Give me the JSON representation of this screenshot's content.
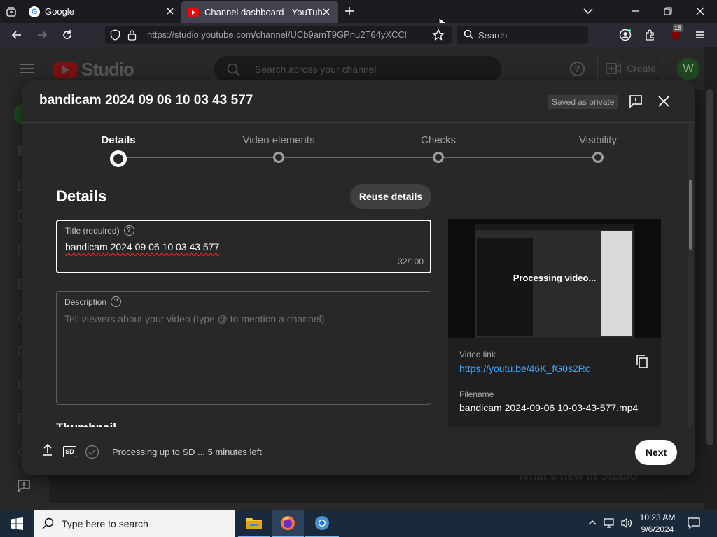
{
  "browser": {
    "tabs": [
      {
        "title": "Google"
      },
      {
        "title": "Channel dashboard - YouTube S"
      }
    ],
    "url": "https://studio.youtube.com/channel/UCb9amT9GPnu2T64yXCCl",
    "search_placeholder": "Search",
    "extension_badge": "15"
  },
  "studio": {
    "logo_text": "Studio",
    "search_placeholder": "Search across your channel",
    "create_label": "Create",
    "avatar_letter": "W",
    "behind_text": "What's new in Studio"
  },
  "modal": {
    "title": "bandicam 2024 09 06 10 03 43 577",
    "saved_badge": "Saved as private",
    "steps": [
      "Details",
      "Video elements",
      "Checks",
      "Visibility"
    ],
    "active_step": 0,
    "section_heading": "Details",
    "reuse_button": "Reuse details",
    "title_field": {
      "label": "Title (required)",
      "value": "bandicam 2024 09 06 10 03 43 577",
      "counter": "32/100"
    },
    "description_field": {
      "label": "Description",
      "placeholder": "Tell viewers about your video (type @ to mention a channel)"
    },
    "thumbnail_heading": "Thumbnail",
    "preview": {
      "overlay_text": "Processing video...",
      "video_link_label": "Video link",
      "video_link": "https://youtu.be/46K_fG0s2Rc",
      "filename_label": "Filename",
      "filename": "bandicam 2024-09-06 10-03-43-577.mp4"
    },
    "footer": {
      "sd_label": "SD",
      "status": "Processing up to SD ... 5 minutes left",
      "next_button": "Next"
    }
  },
  "taskbar": {
    "search_placeholder": "Type here to search",
    "time": "10:23 AM",
    "date": "9/6/2024"
  },
  "colors": {
    "accent_blue": "#3ea6ff",
    "youtube_red": "#ff0000",
    "modal_bg": "#282828",
    "avatar_green": "#2e7d32"
  }
}
